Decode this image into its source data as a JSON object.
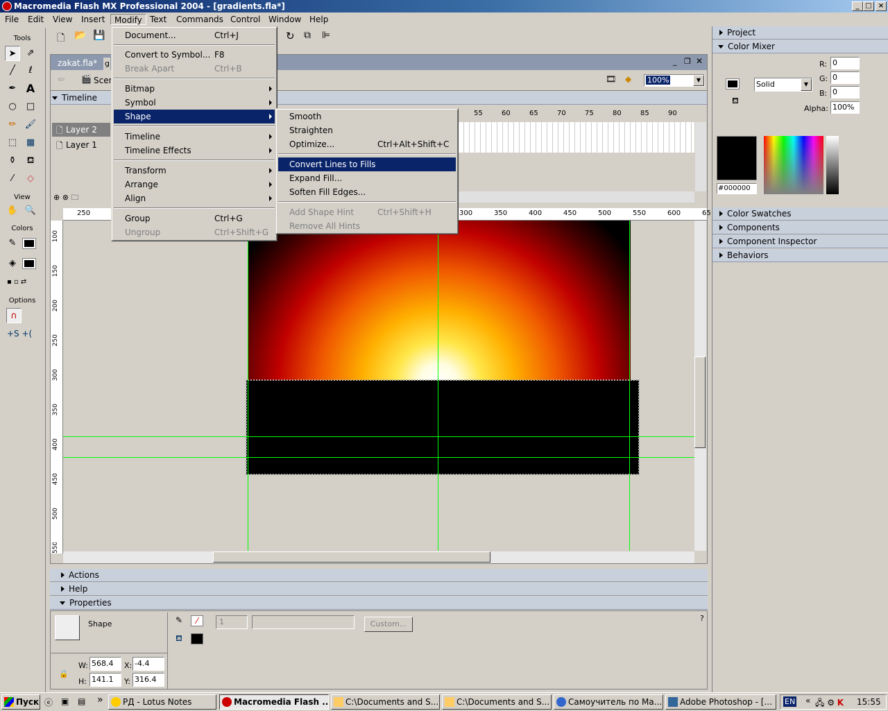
{
  "window": {
    "title": "Macromedia Flash MX Professional 2004 - [gradients.fla*]",
    "min": "_",
    "max": "□",
    "close": "×"
  },
  "menubar": [
    "File",
    "Edit",
    "View",
    "Insert",
    "Modify",
    "Text",
    "Commands",
    "Control",
    "Window",
    "Help"
  ],
  "tools": {
    "label": "Tools",
    "view_label": "View",
    "colors_label": "Colors",
    "options_label": "Options"
  },
  "document": {
    "tab": "zakat.fla*",
    "tab2": "g",
    "scene": "Scen",
    "zoom": "100%"
  },
  "timeline": {
    "label": "Timeline",
    "layers": [
      "Layer 2",
      "Layer 1"
    ],
    "frames": [
      "55",
      "60",
      "65",
      "70",
      "75",
      "80",
      "85",
      "90"
    ]
  },
  "ruler": {
    "h": [
      "250",
      "300",
      "350",
      "400",
      "450",
      "500",
      "550",
      "600",
      "65"
    ],
    "v": [
      "100",
      "150",
      "200",
      "250",
      "300",
      "350",
      "400",
      "450",
      "500",
      "550"
    ]
  },
  "modify_menu": {
    "items": [
      {
        "label": "Document...",
        "shortcut": "Ctrl+J"
      },
      {
        "label": "Convert to Symbol...",
        "shortcut": "F8"
      },
      {
        "label": "Break Apart",
        "shortcut": "Ctrl+B"
      },
      {
        "label": "Bitmap"
      },
      {
        "label": "Symbol"
      },
      {
        "label": "Shape"
      },
      {
        "label": "Timeline"
      },
      {
        "label": "Timeline Effects"
      },
      {
        "label": "Transform"
      },
      {
        "label": "Arrange"
      },
      {
        "label": "Align"
      },
      {
        "label": "Group",
        "shortcut": "Ctrl+G"
      },
      {
        "label": "Ungroup",
        "shortcut": "Ctrl+Shift+G"
      }
    ]
  },
  "shape_menu": {
    "items": [
      {
        "label": "Smooth"
      },
      {
        "label": "Straighten"
      },
      {
        "label": "Optimize...",
        "shortcut": "Ctrl+Alt+Shift+C"
      },
      {
        "label": "Convert Lines to Fills"
      },
      {
        "label": "Expand Fill..."
      },
      {
        "label": "Soften Fill Edges..."
      },
      {
        "label": "Add Shape Hint",
        "shortcut": "Ctrl+Shift+H"
      },
      {
        "label": "Remove All Hints"
      }
    ]
  },
  "right_panels": {
    "project": "Project",
    "color_mixer": "Color Mixer",
    "r_label": "R:",
    "g_label": "G:",
    "b_label": "B:",
    "r": "0",
    "g": "0",
    "b": "0",
    "fill_type": "Solid",
    "alpha_label": "Alpha:",
    "alpha": "100%",
    "hex": "#000000",
    "swatches": "Color Swatches",
    "components": "Components",
    "inspector": "Component Inspector",
    "behaviors": "Behaviors"
  },
  "bottom_panels": {
    "actions": "Actions",
    "help": "Help",
    "properties": "Properties"
  },
  "properties": {
    "type": "Shape",
    "stroke_size": "1",
    "custom": "Custom...",
    "w_label": "W:",
    "h_label": "H:",
    "x_label": "X:",
    "y_label": "Y:",
    "w": "568.4",
    "h": "141.1",
    "x": "-4.4",
    "y": "316.4"
  },
  "taskbar": {
    "start": "Пуск",
    "tasks": [
      "РД  - Lotus Notes",
      "Macromedia Flash ...",
      "C:\\Documents and S...",
      "C:\\Documents and S...",
      "Самоучитель по Ма...",
      "Adobe Photoshop - [..."
    ],
    "lang": "EN",
    "time": "15:55"
  },
  "colors": {
    "accent": "#0a246a",
    "panel_head": "#c8d0dc",
    "guide": "#00ff00"
  }
}
